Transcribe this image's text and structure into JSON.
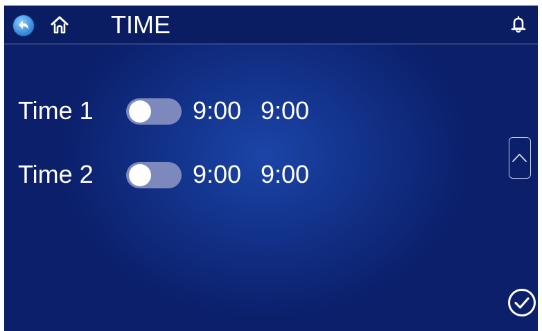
{
  "header": {
    "title": "TIME",
    "icons": {
      "back": "back-arrow-icon",
      "home": "home-icon",
      "notification": "bell-icon"
    }
  },
  "schedules": [
    {
      "label": "Time 1",
      "enabled": false,
      "start": "9:00",
      "end": "9:00"
    },
    {
      "label": "Time 2",
      "enabled": false,
      "start": "9:00",
      "end": "9:00"
    }
  ],
  "side_controls": {
    "scroll_up_icon": "chevron-up-icon",
    "confirm_icon": "check-circle-icon"
  },
  "colors": {
    "background": "#13338c",
    "topbar": "#0a1c62",
    "toggle_off_track": "#7d88bd",
    "text": "#ffffff"
  }
}
